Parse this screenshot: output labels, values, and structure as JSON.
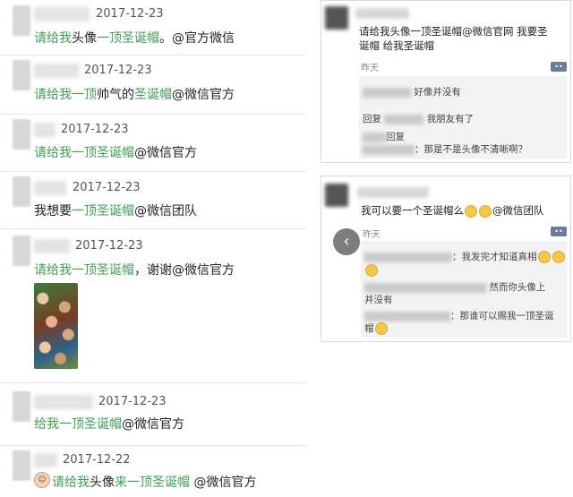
{
  "left_posts": [
    {
      "date": "2017-12-23",
      "parts": [
        [
          "g",
          "请给我"
        ],
        [
          "k",
          "头像"
        ],
        [
          "g",
          "一顶圣诞帽"
        ],
        [
          "k",
          "。@官方微信"
        ]
      ]
    },
    {
      "date": "2017-12-23",
      "parts": [
        [
          "g",
          "请给我一顶"
        ],
        [
          "k",
          "帅气的"
        ],
        [
          "g",
          "圣诞帽"
        ],
        [
          "k",
          "@微信官方"
        ]
      ]
    },
    {
      "date": "2017-12-23",
      "parts": [
        [
          "g",
          "请给我一顶圣诞帽"
        ],
        [
          "k",
          "@微信官方"
        ]
      ]
    },
    {
      "date": "2017-12-23",
      "parts": [
        [
          "k",
          "我想要"
        ],
        [
          "g",
          "一顶圣诞帽"
        ],
        [
          "k",
          "@微信团队"
        ]
      ]
    },
    {
      "date": "2017-12-23",
      "parts": [
        [
          "g",
          "请给我一顶圣诞帽"
        ],
        [
          "k",
          "，谢谢@微信官方"
        ]
      ]
    },
    {
      "date": "2017-12-23",
      "parts": [
        [
          "g",
          "给我一顶圣诞帽"
        ],
        [
          "k",
          "@微信官方"
        ]
      ]
    },
    {
      "date": "2017-12-22",
      "parts": [
        [
          "g",
          "请给我"
        ],
        [
          "k",
          "头像"
        ],
        [
          "g",
          "来一顶圣诞帽"
        ],
        [
          "k",
          " @微信官方"
        ]
      ]
    }
  ],
  "card1": {
    "text_line1": "请给我头像一顶圣诞帽@微信官网 我要圣",
    "text_line2": "诞帽 给我圣诞帽",
    "time": "昨天",
    "comments": [
      "好像并没有",
      "回复",
      "我朋友有了",
      "回复",
      "：那是不是头像不清晰啊？"
    ]
  },
  "card2": {
    "text": "我可以要一个圣诞帽么",
    "text_tail": "@微信团队",
    "time": "昨天",
    "comments": [
      "：我发完才知道真相",
      "然而你头像上",
      "并没有",
      "：那谁可以赐我一顶圣诞",
      "帽"
    ]
  },
  "icons": {
    "back": "chevron-left-icon",
    "comment": "comment-icon",
    "emoji": "smile-icon"
  }
}
